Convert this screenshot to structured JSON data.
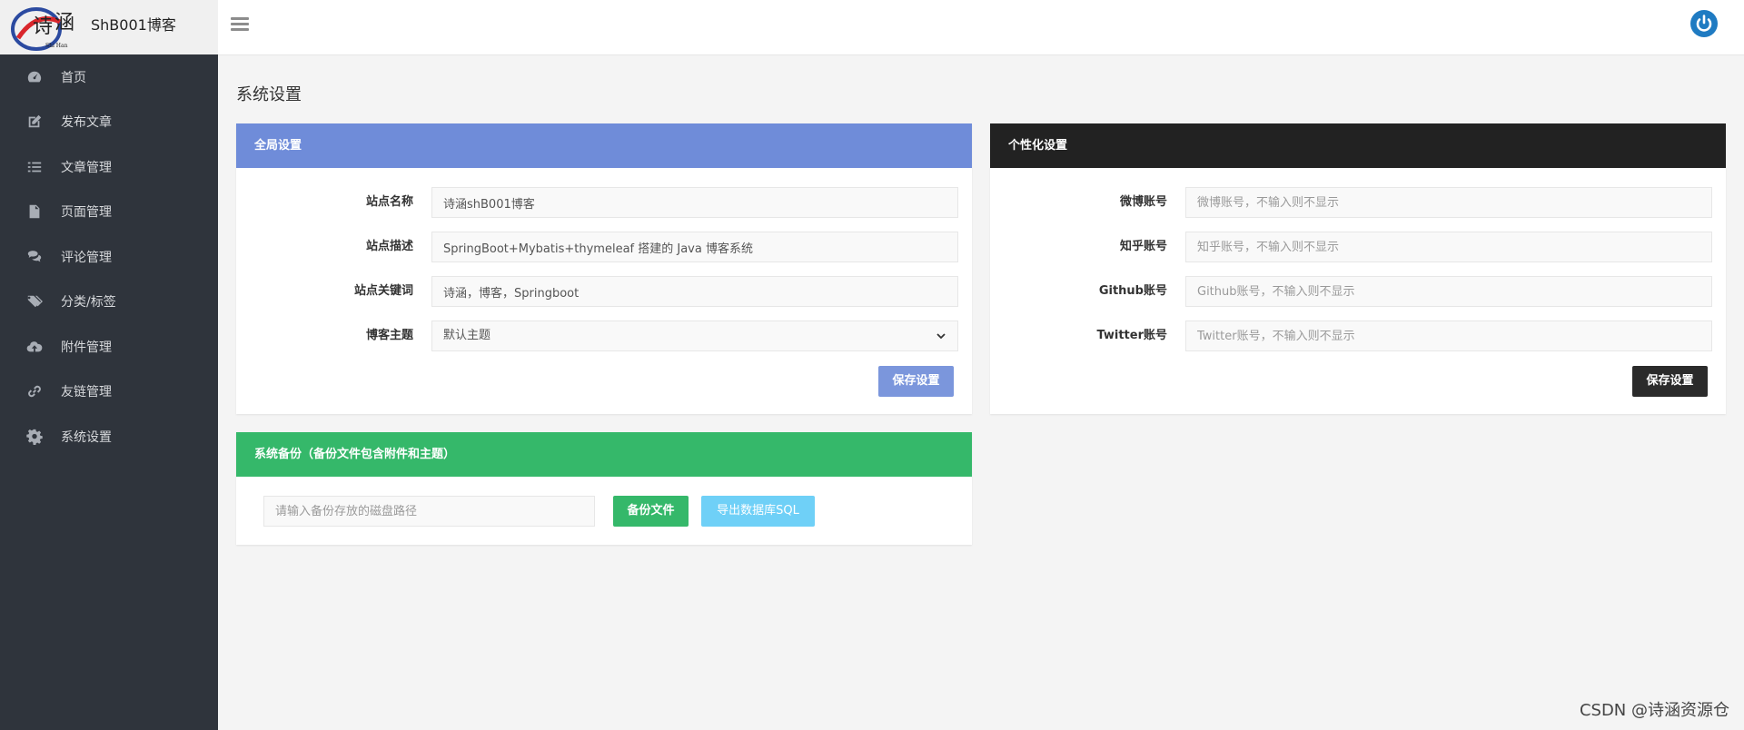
{
  "app": {
    "site_name": "ShB001博客"
  },
  "nav": {
    "items": [
      {
        "label": "首页"
      },
      {
        "label": "发布文章"
      },
      {
        "label": "文章管理"
      },
      {
        "label": "页面管理"
      },
      {
        "label": "评论管理"
      },
      {
        "label": "分类/标签"
      },
      {
        "label": "附件管理"
      },
      {
        "label": "友链管理"
      },
      {
        "label": "系统设置"
      }
    ]
  },
  "page": {
    "title": "系统设置"
  },
  "global_settings": {
    "header": "全局设置",
    "header_color": "#6f8cd9",
    "fields": [
      {
        "label": "站点名称",
        "value": "诗涵shB001博客"
      },
      {
        "label": "站点描述",
        "value": "SpringBoot+Mybatis+thymeleaf 搭建的 Java 博客系统"
      },
      {
        "label": "站点关键词",
        "value": "诗涵，博客，Springboot"
      },
      {
        "label": "博客主题",
        "value": "默认主题"
      }
    ],
    "save_label": "保存设置"
  },
  "personal_settings": {
    "header": "个性化设置",
    "header_color": "#222222",
    "fields": [
      {
        "label": "微博账号",
        "placeholder": "微博账号，不输入则不显示"
      },
      {
        "label": "知乎账号",
        "placeholder": "知乎账号，不输入则不显示"
      },
      {
        "label": "Github账号",
        "placeholder": "Github账号，不输入则不显示"
      },
      {
        "label": "Twitter账号",
        "placeholder": "Twitter账号，不输入则不显示"
      }
    ],
    "save_label": "保存设置"
  },
  "backup": {
    "header": "系统备份（备份文件包含附件和主题）",
    "header_color": "#35b86a",
    "path_placeholder": "请输入备份存放的磁盘路径",
    "backup_files_label": "备份文件",
    "export_sql_label": "导出数据库SQL"
  },
  "watermark": "CSDN @诗涵资源仓"
}
